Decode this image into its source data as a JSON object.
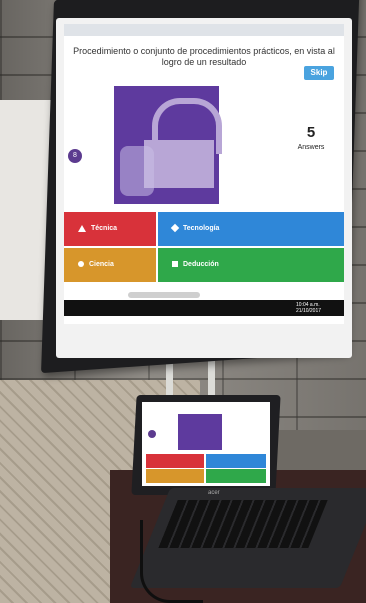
{
  "screen": {
    "question": "Procedimiento o conjunto de procedimientos prácticos, en vista al logro de un resultado",
    "skip_label": "Skip",
    "timer": "8",
    "answers_count": "5",
    "answers_label": "Answers",
    "answers": [
      {
        "label": "Técnica",
        "color": "#d8323a",
        "shape": "triangle"
      },
      {
        "label": "Tecnología",
        "color": "#2f87d8",
        "shape": "diamond"
      },
      {
        "label": "Ciencia",
        "color": "#d7962b",
        "shape": "circle"
      },
      {
        "label": "Deducción",
        "color": "#2fa84a",
        "shape": "square"
      }
    ],
    "clock_time": "10:04 a.m.",
    "clock_date": "21/10/2017"
  },
  "laptop": {
    "brand": "acer"
  }
}
